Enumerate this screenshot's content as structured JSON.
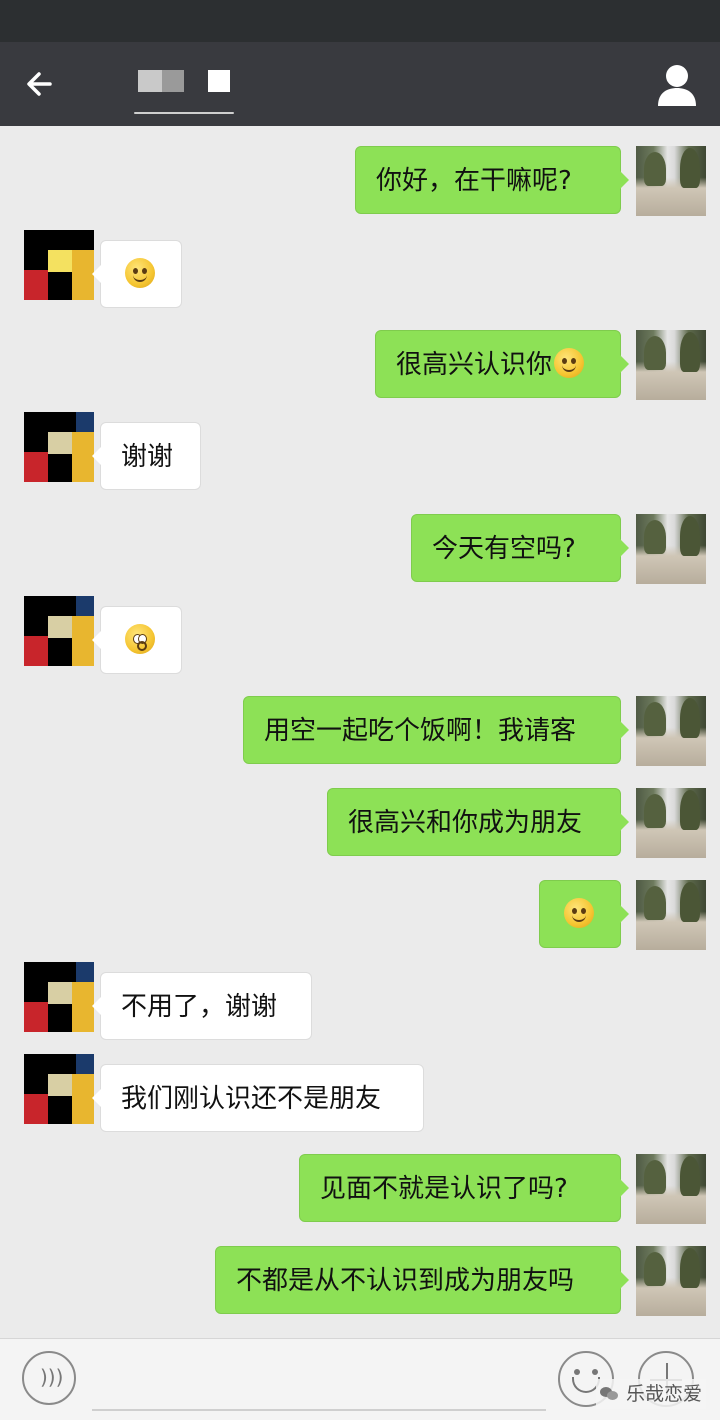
{
  "header": {
    "title": "",
    "back_icon": "arrow-left-icon",
    "profile_icon": "person-icon",
    "background": "#393a3f"
  },
  "colors": {
    "outgoing_bubble": "#8de156",
    "incoming_bubble": "#ffffff",
    "chat_background": "#ebebeb"
  },
  "messages": [
    {
      "sender": "self",
      "text": "你好，在干嘛呢?"
    },
    {
      "sender": "other",
      "text": "",
      "emoji": "smile-emoji"
    },
    {
      "sender": "self",
      "text": "很高兴认识你",
      "emoji": "smile-emoji"
    },
    {
      "sender": "other",
      "text": "谢谢"
    },
    {
      "sender": "self",
      "text": "今天有空吗?"
    },
    {
      "sender": "other",
      "text": "",
      "emoji": "shocked-emoji"
    },
    {
      "sender": "self",
      "text": "用空一起吃个饭啊！我请客"
    },
    {
      "sender": "self",
      "text": "很高兴和你成为朋友"
    },
    {
      "sender": "self",
      "text": "",
      "emoji": "smile-emoji"
    },
    {
      "sender": "other",
      "text": "不用了，谢谢"
    },
    {
      "sender": "other",
      "text": "我们刚认识还不是朋友"
    },
    {
      "sender": "self",
      "text": "见面不就是认识了吗?"
    },
    {
      "sender": "self",
      "text": "不都是从不认识到成为朋友吗"
    }
  ],
  "input_bar": {
    "placeholder": "",
    "voice_icon": "voice-icon",
    "emoji_icon": "emoji-icon",
    "plus_icon": "plus-icon"
  },
  "watermark": "乐哉恋爱"
}
